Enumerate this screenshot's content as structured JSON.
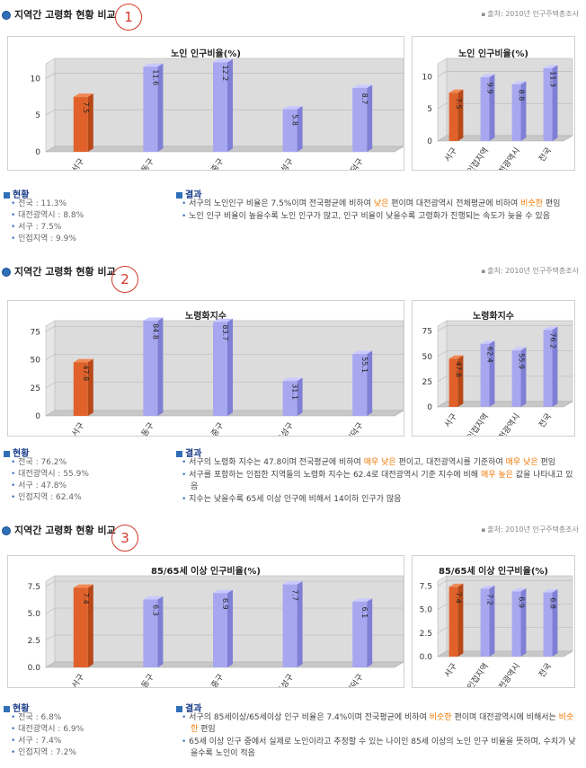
{
  "sections": [
    {
      "title": "지역간 고령화 현황 비교",
      "number": "1",
      "source": "출처: 2010년 인구주택총조사",
      "status_head": "현황",
      "status": [
        "전국 : 11.3%",
        "대전광역시 : 8.8%",
        "서구 : 7.5%",
        "인접지역 : 9.9%"
      ],
      "result_head": "결과",
      "results": [
        {
          "parts": [
            {
              "t": "서구의 노인인구 비율은 7.5%이며 전국평균에 비하여 "
            },
            {
              "t": "낮은",
              "hl": true
            },
            {
              "t": " 편이며 대전광역시 전체평균에 비하여 "
            },
            {
              "t": "비슷한",
              "hl": true
            },
            {
              "t": " 편임"
            }
          ]
        },
        {
          "parts": [
            {
              "t": "노인 인구 비율이 높을수록 노인 인구가 많고, 인구 비율이 낮을수록 고령화가 진행되는 속도가 늦을 수 있음"
            }
          ]
        }
      ]
    },
    {
      "title": "지역간 고령화 현황 비교",
      "number": "2",
      "source": "출처: 2010년 인구주택총조사",
      "status_head": "현황",
      "status": [
        "전국 : 76.2%",
        "대전광역시 : 55.9%",
        "서구 : 47.8%",
        "인접지역 : 62.4%"
      ],
      "result_head": "결과",
      "results": [
        {
          "parts": [
            {
              "t": "서구의 노령화 지수는 47.8이며 전국평균에 비하여 "
            },
            {
              "t": "매우 낮은",
              "hl": true
            },
            {
              "t": " 편이고, 대전광역시를 기준하여 "
            },
            {
              "t": "매우 낮은",
              "hl": true
            },
            {
              "t": " 편임"
            }
          ]
        },
        {
          "parts": [
            {
              "t": "서구를 포함하는 인접한 지역들의 노령화 지수는 62.4로 대전광역시 기준 지수에 비해 "
            },
            {
              "t": "매우 높은",
              "hl": true
            },
            {
              "t": " 값을 나타내고 있음"
            }
          ]
        },
        {
          "parts": [
            {
              "t": "지수는 낮을수록 65세 이상 인구에 비해서 14이하 인구가 많음"
            }
          ]
        }
      ]
    },
    {
      "title": "지역간 고령화 현황 비교",
      "number": "3",
      "source": "출처: 2010년 인구주택총조사",
      "status_head": "현황",
      "status": [
        "전국 : 6.8%",
        "대전광역시 : 6.9%",
        "서구 : 7.4%",
        "인접지역 : 7.2%"
      ],
      "result_head": "결과",
      "results": [
        {
          "parts": [
            {
              "t": "서구의 85세이상/65세이상 인구 비율은 7.4%이며 전국평균에 비하여 "
            },
            {
              "t": "비슷한",
              "hl": true
            },
            {
              "t": " 편이며 대전광역시에 비해서는 "
            },
            {
              "t": "비슷한",
              "hl": true
            },
            {
              "t": " 편임"
            }
          ]
        },
        {
          "parts": [
            {
              "t": "65세 이상 인구 중에서 실제로 노인이라고 추정할 수 있는 나이인 85세 이상의 노인 인구 비율을 뜻하며, 수치가 낮을수록 노인이 적음"
            }
          ]
        }
      ]
    }
  ],
  "chart_data": [
    {
      "type": "bar",
      "title": "노인 인구비율(%)",
      "categories": [
        "서구",
        "동구",
        "중구",
        "유성구",
        "대덕구"
      ],
      "values": [
        7.5,
        11.6,
        12.2,
        5.8,
        8.7
      ],
      "ylim": [
        0,
        12
      ],
      "yticks": [
        0,
        5,
        10
      ],
      "highlight_index": 0
    },
    {
      "type": "bar",
      "title": "노인 인구비율(%)",
      "categories": [
        "서구",
        "인접지역",
        "대전광역시",
        "전국"
      ],
      "values": [
        7.5,
        9.9,
        8.8,
        11.3
      ],
      "ylim": [
        0,
        12
      ],
      "yticks": [
        0,
        5,
        10
      ],
      "highlight_index": 0
    },
    {
      "type": "bar",
      "title": "노령화지수",
      "categories": [
        "서구",
        "동구",
        "중구",
        "유성구",
        "대덕구"
      ],
      "values": [
        47.8,
        84.8,
        83.7,
        31.1,
        55.1
      ],
      "ylim": [
        0,
        80
      ],
      "yticks": [
        0,
        25,
        50,
        75
      ],
      "highlight_index": 0
    },
    {
      "type": "bar",
      "title": "노령화지수",
      "categories": [
        "서구",
        "인접지역",
        "대전광역시",
        "전국"
      ],
      "values": [
        47.8,
        62.4,
        55.9,
        76.2
      ],
      "ylim": [
        0,
        80
      ],
      "yticks": [
        0,
        25,
        50,
        75
      ],
      "highlight_index": 0
    },
    {
      "type": "bar",
      "title": "85/65세 이상 인구비율(%)",
      "categories": [
        "서구",
        "동구",
        "중구",
        "유성구",
        "대덕구"
      ],
      "values": [
        7.4,
        6.3,
        6.9,
        7.7,
        6.1
      ],
      "ylim": [
        0,
        8
      ],
      "yticks": [
        0.0,
        2.5,
        5.0,
        7.5
      ],
      "highlight_index": 0
    },
    {
      "type": "bar",
      "title": "85/65세 이상 인구비율(%)",
      "categories": [
        "서구",
        "인접지역",
        "대전광역시",
        "전국"
      ],
      "values": [
        7.4,
        7.2,
        6.9,
        6.8
      ],
      "ylim": [
        0,
        8
      ],
      "yticks": [
        0,
        2.5,
        5,
        7.5
      ],
      "highlight_index": 0
    }
  ],
  "colors": {
    "highlight": "#e0622a",
    "bar": "#a7a7f0",
    "bar_side": "#7f7fd6",
    "bar_top": "#c9c9ff",
    "floor": "#c8c8c8",
    "back": "#dcdcdc"
  }
}
